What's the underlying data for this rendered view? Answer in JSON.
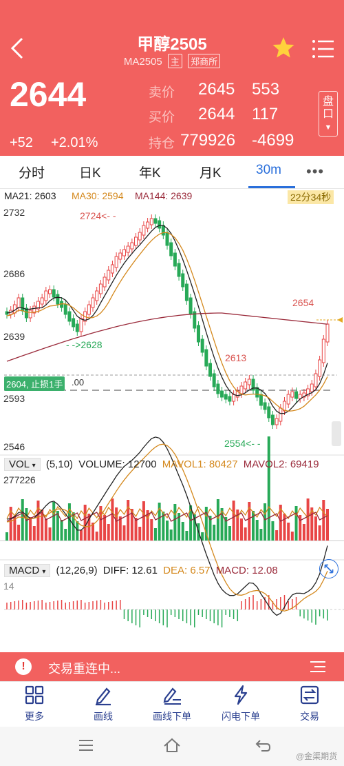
{
  "header": {
    "title": "甲醇2505",
    "contract": "MA2505",
    "tag_main": "主",
    "tag_exchange": "郑商所",
    "last_price": "2644",
    "change": "+52",
    "change_pct": "+2.01%",
    "ask_label": "卖价",
    "ask_price": "2645",
    "ask_vol": "553",
    "bid_label": "买价",
    "bid_price": "2644",
    "bid_vol": "117",
    "oi_label": "持仓",
    "oi_value": "779926",
    "oi_change": "-4699",
    "pankou_label": "盘口"
  },
  "tabs": [
    "分时",
    "日K",
    "年K",
    "月K",
    "30m"
  ],
  "active_tab": "30m",
  "more_label": "•••",
  "main_chart": {
    "ma21": "MA21: 2603",
    "ma30": "MA30: 2594",
    "ma144": "MA144: 2639",
    "timer": "22分34秒",
    "y_labels": [
      "2732",
      "2686",
      "2639",
      "2593",
      "2546"
    ],
    "ann_high": "2724<- -",
    "ann_left": "- ->2628",
    "ann_mid": "2613",
    "ann_right": "2654",
    "ann_low": "2554<- -",
    "stop_badge": "2604, 止损1手",
    "stop_tail": ".00"
  },
  "vol": {
    "selector": "VOL",
    "params": "(5,10)",
    "volume": "VOLUME: 12700",
    "mavol1": "MAVOL1: 80427",
    "mavol2": "MAVOL2: 69419",
    "max_label": "277226"
  },
  "macd": {
    "selector": "MACD",
    "params": "(12,26,9)",
    "diff": "DIFF: 12.61",
    "dea": "DEA: 6.57",
    "macd": "MACD: 12.08",
    "top_label": "14"
  },
  "alert": {
    "text": "交易重连中..."
  },
  "nav": [
    {
      "label": "更多",
      "icon": "grid-icon"
    },
    {
      "label": "画线",
      "icon": "pen-icon"
    },
    {
      "label": "画线下单",
      "icon": "pen-order-icon"
    },
    {
      "label": "闪电下单",
      "icon": "lightning-icon"
    },
    {
      "label": "交易",
      "icon": "trade-icon"
    }
  ],
  "watermark": "@金渠期货",
  "colors": {
    "brand": "#f2615f",
    "up": "#e84545",
    "down": "#27a957",
    "accent": "#2a6fdb"
  }
}
